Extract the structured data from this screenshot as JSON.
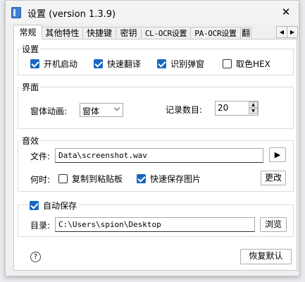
{
  "window": {
    "title": "设置 (version 1.3.9)",
    "close_glyph": "✕"
  },
  "tabs": [
    "常规",
    "其他特性",
    "快捷键",
    "密钥",
    "CL-OCR设置",
    "PA-OCR设置",
    "翻"
  ],
  "tab_scroll": {
    "left": "◀",
    "right": "▶"
  },
  "settings_group": {
    "title": "设置",
    "items": [
      {
        "label": "开机启动",
        "checked": true
      },
      {
        "label": "快速翻译",
        "checked": true
      },
      {
        "label": "识别弹窗",
        "checked": true
      },
      {
        "label": "取色HEX",
        "checked": false
      }
    ]
  },
  "ui_group": {
    "title": "界面",
    "animation_label": "窗体动画:",
    "animation_value": "窗体",
    "records_label": "记录数目:",
    "records_value": "20"
  },
  "sound_group": {
    "title": "音效",
    "file_label": "文件:",
    "file_value": "Data\\screenshot.wav",
    "play_glyph": "▶",
    "when_label": "何时:",
    "copy_option": {
      "label": "复制到粘贴板",
      "checked": false
    },
    "save_option": {
      "label": "快速保存图片",
      "checked": true
    },
    "change_button": "更改"
  },
  "autosave_group": {
    "title": "自动保存",
    "checked": true,
    "dir_label": "目录:",
    "dir_value": "C:\\Users\\spion\\Desktop",
    "browse_button": "浏览"
  },
  "footer": {
    "help_glyph": "?",
    "restore_button": "恢复默认"
  }
}
